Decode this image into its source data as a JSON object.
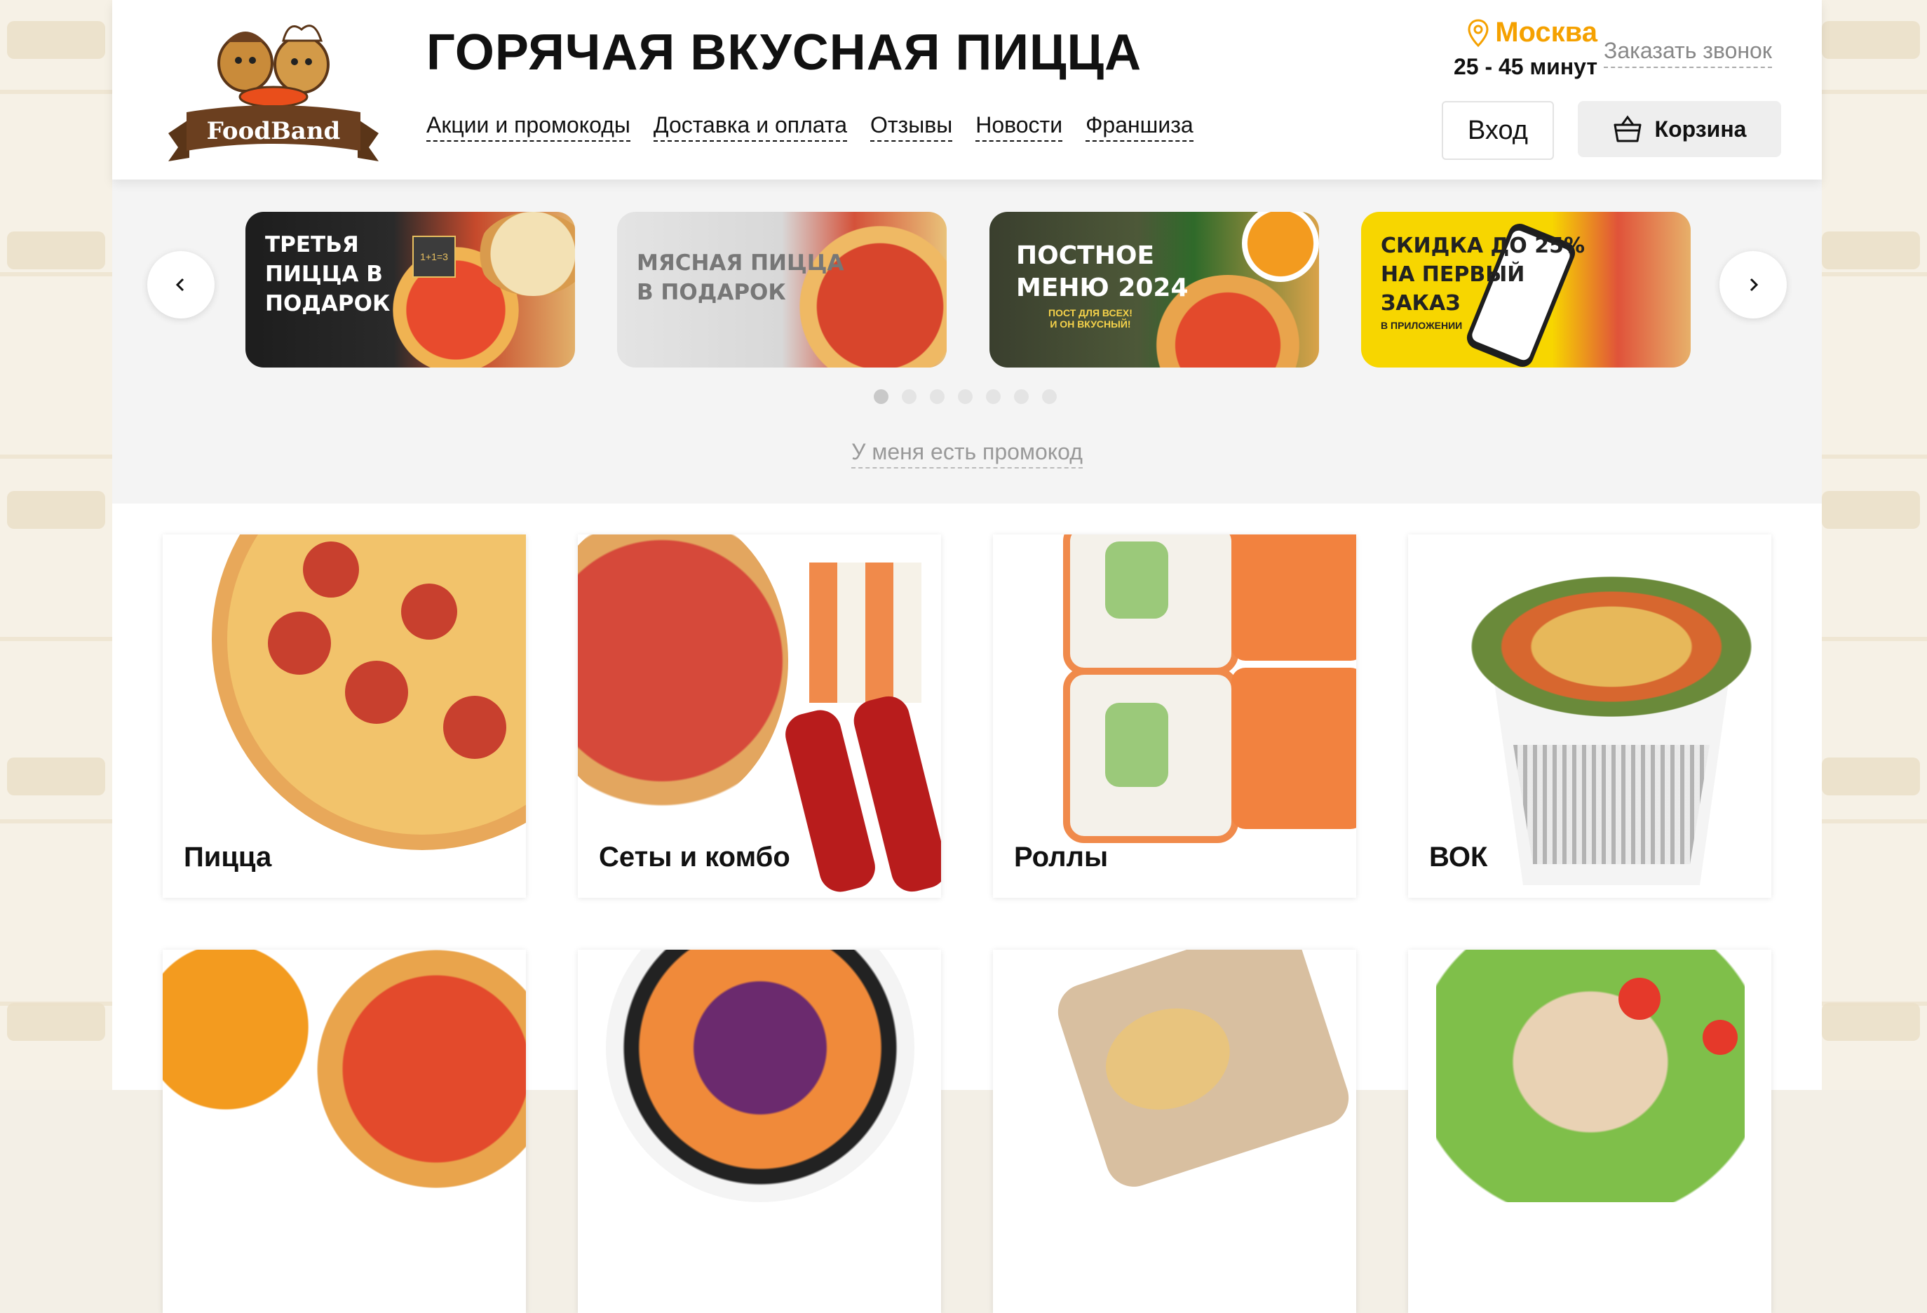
{
  "brand": {
    "name": "FoodBand",
    "colors": {
      "accent": "#f5a100",
      "brown": "#6b3f1f"
    }
  },
  "header": {
    "headline": "ГОРЯЧАЯ ВКУСНАЯ ПИЦЦА",
    "nav": [
      "Акции и промокоды",
      "Доставка и оплата",
      "Отзывы",
      "Новости",
      "Франшиза"
    ],
    "city": "Москва",
    "city_icon": "location-pin-icon",
    "delivery_time": "25 - 45 минут",
    "callback": "Заказать звонок",
    "login": "Вход",
    "cart": "Корзина",
    "cart_icon": "basket-icon"
  },
  "promo": {
    "banners": [
      {
        "text": "ТРЕТЬЯ\nПИЦЦА В\nПОДАРОК",
        "badge": "1+1=3"
      },
      {
        "text": "МЯСНАЯ ПИЦЦА\nВ ПОДАРОК"
      },
      {
        "text": "ПОСТНОЕ\nМЕНЮ 2024",
        "small": "ПОСТ ДЛЯ ВСЕХ!\nИ ОН ВКУСНЫЙ!"
      },
      {
        "text": "СКИДКА ДО 25%\nНА ПЕРВЫЙ\nЗАКАЗ",
        "small": "В ПРИЛОЖЕНИИ"
      }
    ],
    "dots_total": 7,
    "active_dot": 1,
    "promo_link": "У меня есть промокод"
  },
  "categories": [
    {
      "label": "Пицца"
    },
    {
      "label": "Сеты и комбо"
    },
    {
      "label": "Роллы"
    },
    {
      "label": "ВОК"
    },
    {
      "label": ""
    },
    {
      "label": ""
    },
    {
      "label": ""
    },
    {
      "label": ""
    }
  ]
}
